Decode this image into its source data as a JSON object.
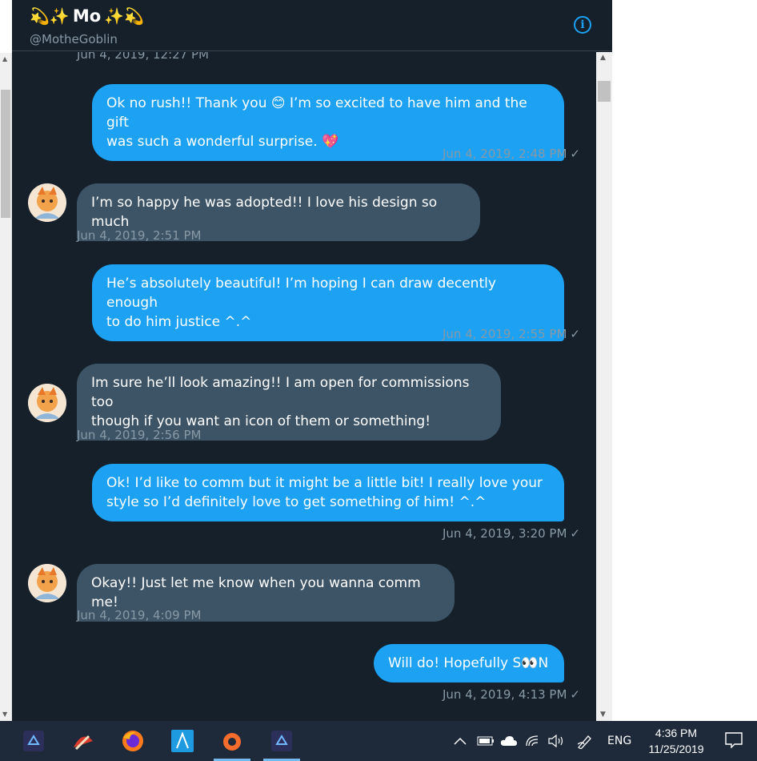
{
  "header": {
    "name": "Mo",
    "name_emoji_left": "💫✨",
    "name_emoji_right": "✨💫",
    "handle": "@MotheGoblin",
    "info_icon": "info-icon"
  },
  "messages": [
    {
      "type": "timestamp",
      "side": "recv",
      "time": "Jun 4, 2019, 12:27 PM"
    },
    {
      "type": "bubble",
      "side": "sent",
      "lines": [
        "Ok no rush!! Thank you 😊 I’m so excited to have him and the gift",
        "was such a wonderful surprise. 💖"
      ],
      "time": "Jun 4, 2019, 2:48 PM"
    },
    {
      "type": "bubble",
      "side": "recv",
      "lines": [
        "I’m so happy he was adopted!! I love his design so much"
      ],
      "time": "Jun 4, 2019, 2:51 PM"
    },
    {
      "type": "bubble",
      "side": "sent",
      "lines": [
        "He’s absolutely beautiful! I’m hoping I can draw decently enough",
        "to do him justice ^.^"
      ],
      "time": "Jun 4, 2019, 2:55 PM"
    },
    {
      "type": "bubble",
      "side": "recv",
      "lines": [
        "Im sure he’ll look amazing!! I am open for commissions too",
        "though if you want an icon of them or something!"
      ],
      "time": "Jun 4, 2019, 2:56 PM"
    },
    {
      "type": "bubble",
      "side": "sent",
      "lines": [
        "Ok! I’d like to comm but it might be a little bit! I really love your",
        "style so I’d definitely love to get something of him! ^.^"
      ],
      "time": "Jun 4, 2019, 3:20 PM"
    },
    {
      "type": "bubble",
      "side": "recv",
      "lines": [
        "Okay!! Just let me know when you wanna comm me!"
      ],
      "time": "Jun 4, 2019, 4:09 PM"
    },
    {
      "type": "bubble",
      "side": "sent",
      "lines": [
        "Will do! Hopefully S👀N"
      ],
      "time": "Jun 4, 2019, 4:13 PM"
    }
  ],
  "read_check": "✓",
  "taskbar": {
    "apps": [
      {
        "name": "affinity-photo-icon",
        "active": false
      },
      {
        "name": "paint-tool-icon",
        "active": false
      },
      {
        "name": "firefox-icon",
        "active": false
      },
      {
        "name": "affinity-designer-icon",
        "active": false
      },
      {
        "name": "origin-icon",
        "active": true
      },
      {
        "name": "affinity-photo-icon-2",
        "active": true
      }
    ],
    "language": "ENG",
    "time": "4:36 PM",
    "date": "11/25/2019"
  },
  "colors": {
    "background": "#15202b",
    "sent_bubble": "#1da1f2",
    "recv_bubble": "#3d5466",
    "muted": "#8899a6",
    "taskbar": "#1e2a3a"
  }
}
